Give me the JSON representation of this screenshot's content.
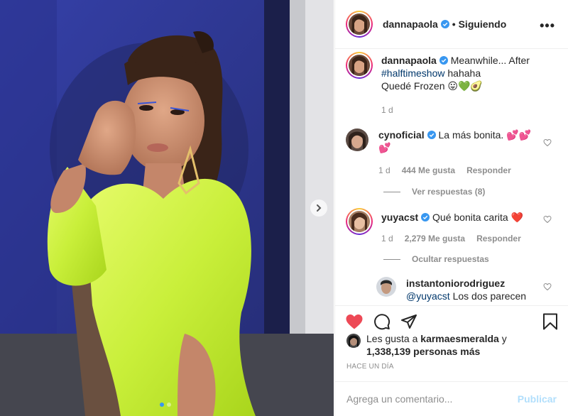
{
  "post": {
    "username": "dannapaola",
    "follow_status": "• Siguiendo",
    "more": "•••"
  },
  "caption": {
    "username": "dannapaola",
    "text_1": "Meanwhile... After",
    "hashtag": "#halftimeshow",
    "text_2": "hahaha",
    "text_3": "Quedé Frozen 😛💚🥑",
    "time": "1 d"
  },
  "comments": [
    {
      "username": "cynoficial",
      "text": "La más bonita. 💕💕💕",
      "time": "1 d",
      "likes": "444 Me gusta",
      "reply": "Responder",
      "replies_toggle": "Ver respuestas (8)"
    },
    {
      "username": "yuyacst",
      "text": "Qué bonita carita ❤️",
      "time": "1 d",
      "likes": "2,279 Me gusta",
      "reply": "Responder",
      "replies_toggle": "Ocultar respuestas"
    }
  ],
  "reply": {
    "username": "instantoniorodriguez",
    "text_mention": "@yuyacst",
    "text": "Los dos parecen"
  },
  "likes_line": {
    "prefix": "Les gusta a",
    "user": "karmaesmeralda",
    "mid": "y",
    "count": "1,338,139 personas más"
  },
  "timestamp": "HACE UN DÍA",
  "add_comment": {
    "placeholder": "Agrega un comentario...",
    "post_label": "Publicar"
  },
  "colors": {
    "heart_red": "#ed4956",
    "verified_blue": "#3897f0",
    "publish_disabled": "#b2dffc"
  },
  "icons": [
    "verified-badge-icon",
    "more-icon",
    "heart-outline-icon",
    "heart-filled-icon",
    "comment-icon",
    "share-icon",
    "bookmark-icon",
    "chevron-right-icon"
  ]
}
